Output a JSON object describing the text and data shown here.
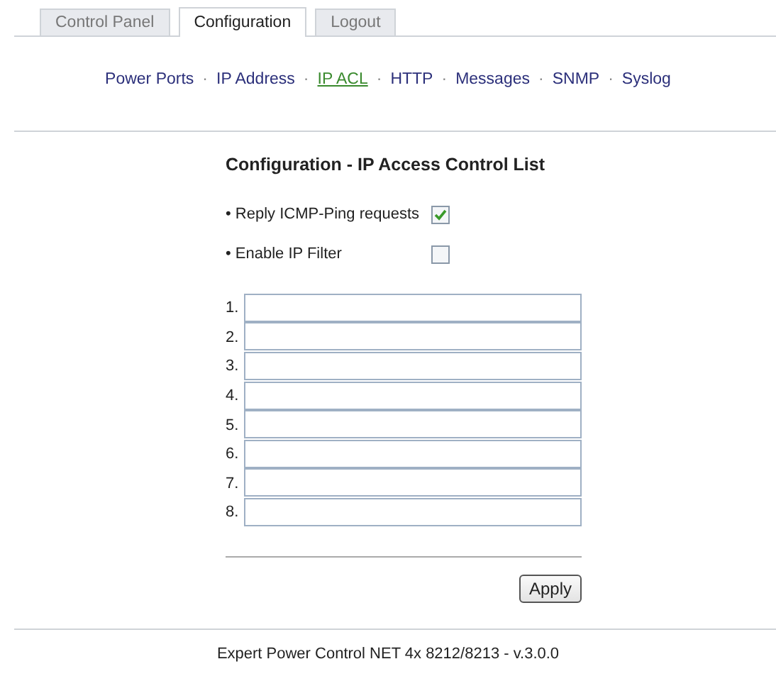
{
  "tabs": [
    {
      "label": "Control Panel",
      "selected": false
    },
    {
      "label": "Configuration",
      "selected": true
    },
    {
      "label": "Logout",
      "selected": false
    }
  ],
  "subnav": {
    "separator": "·",
    "links": [
      {
        "label": "Power Ports",
        "selected": false
      },
      {
        "label": "IP Address",
        "selected": false
      },
      {
        "label": "IP ACL",
        "selected": true
      },
      {
        "label": "HTTP",
        "selected": false
      },
      {
        "label": "Messages",
        "selected": false
      },
      {
        "label": "SNMP",
        "selected": false
      },
      {
        "label": "Syslog",
        "selected": false
      }
    ]
  },
  "form": {
    "title": "Configuration - IP Access Control List",
    "options": [
      {
        "label": "• Reply ICMP-Ping requests",
        "checked": true
      },
      {
        "label": "• Enable IP Filter",
        "checked": false
      }
    ],
    "acl_entries": [
      {
        "label": "1."
      },
      {
        "label": "2."
      },
      {
        "label": "3."
      },
      {
        "label": "4."
      },
      {
        "label": "5."
      },
      {
        "label": "6."
      },
      {
        "label": "7."
      },
      {
        "label": "8."
      }
    ],
    "apply_button": "Apply"
  },
  "footer": "Expert Power Control NET 4x 8212/8213 - v.3.0.0"
}
